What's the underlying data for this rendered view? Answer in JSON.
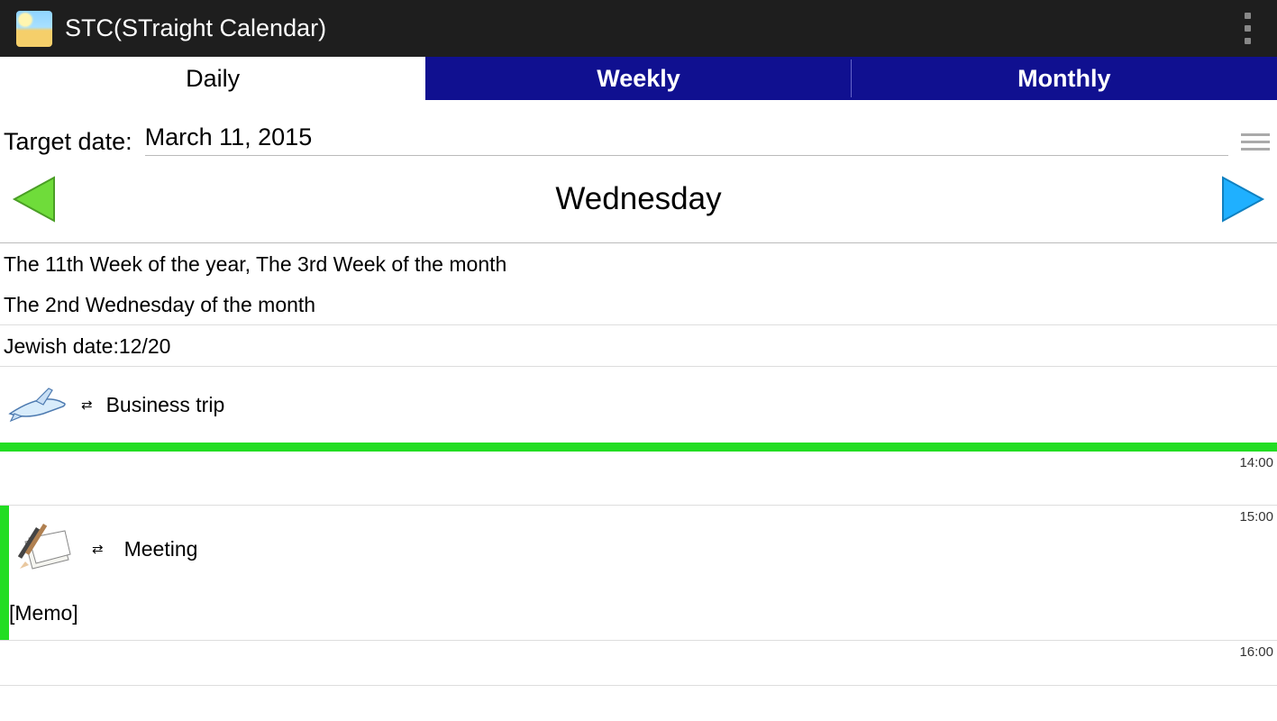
{
  "header": {
    "title": "STC(STraight Calendar)"
  },
  "tabs": {
    "daily": "Daily",
    "weekly": "Weekly",
    "monthly": "Monthly"
  },
  "target": {
    "label": "Target date:",
    "date": "March 11, 2015"
  },
  "day": {
    "name": "Wednesday"
  },
  "info": {
    "line1": "The 11th Week of the year, The 3rd Week of the month",
    "line2": "The 2nd Wednesday of the month",
    "line3": "Jewish date:12/20"
  },
  "events": {
    "allday": {
      "title": "Business trip"
    },
    "meeting": {
      "title": "Meeting",
      "memo": "[Memo]"
    }
  },
  "times": {
    "t14": "14:00",
    "t15": "15:00",
    "t16": "16:00"
  }
}
